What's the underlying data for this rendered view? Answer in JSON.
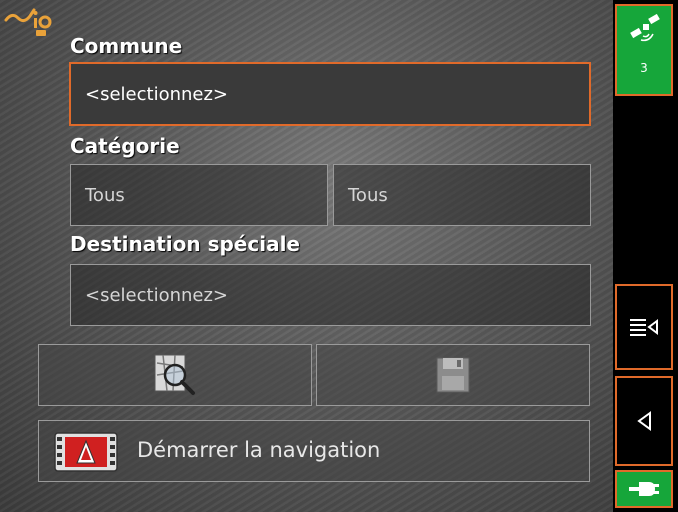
{
  "form": {
    "commune_label": "Commune",
    "commune_value": "<selectionnez>",
    "categorie_label": "Catégorie",
    "categorie_value_1": "Tous",
    "categorie_value_2": "Tous",
    "destination_label": "Destination spéciale",
    "destination_value": "<selectionnez>"
  },
  "actions": {
    "search_icon": "map-search-icon",
    "save_icon": "floppy-disk-icon",
    "start_navigation_label": "Démarrer la navigation",
    "start_navigation_icon": "navigation-film-icon"
  },
  "sidebar": {
    "gps_icon": "satellite-icon",
    "satellite_count": "3",
    "menu_icon": "menu-collapse-icon",
    "back_icon": "back-arrow-icon",
    "power_icon": "power-plug-icon"
  },
  "colors": {
    "accent_border": "#e06a2a",
    "status_green": "#16a63a"
  }
}
